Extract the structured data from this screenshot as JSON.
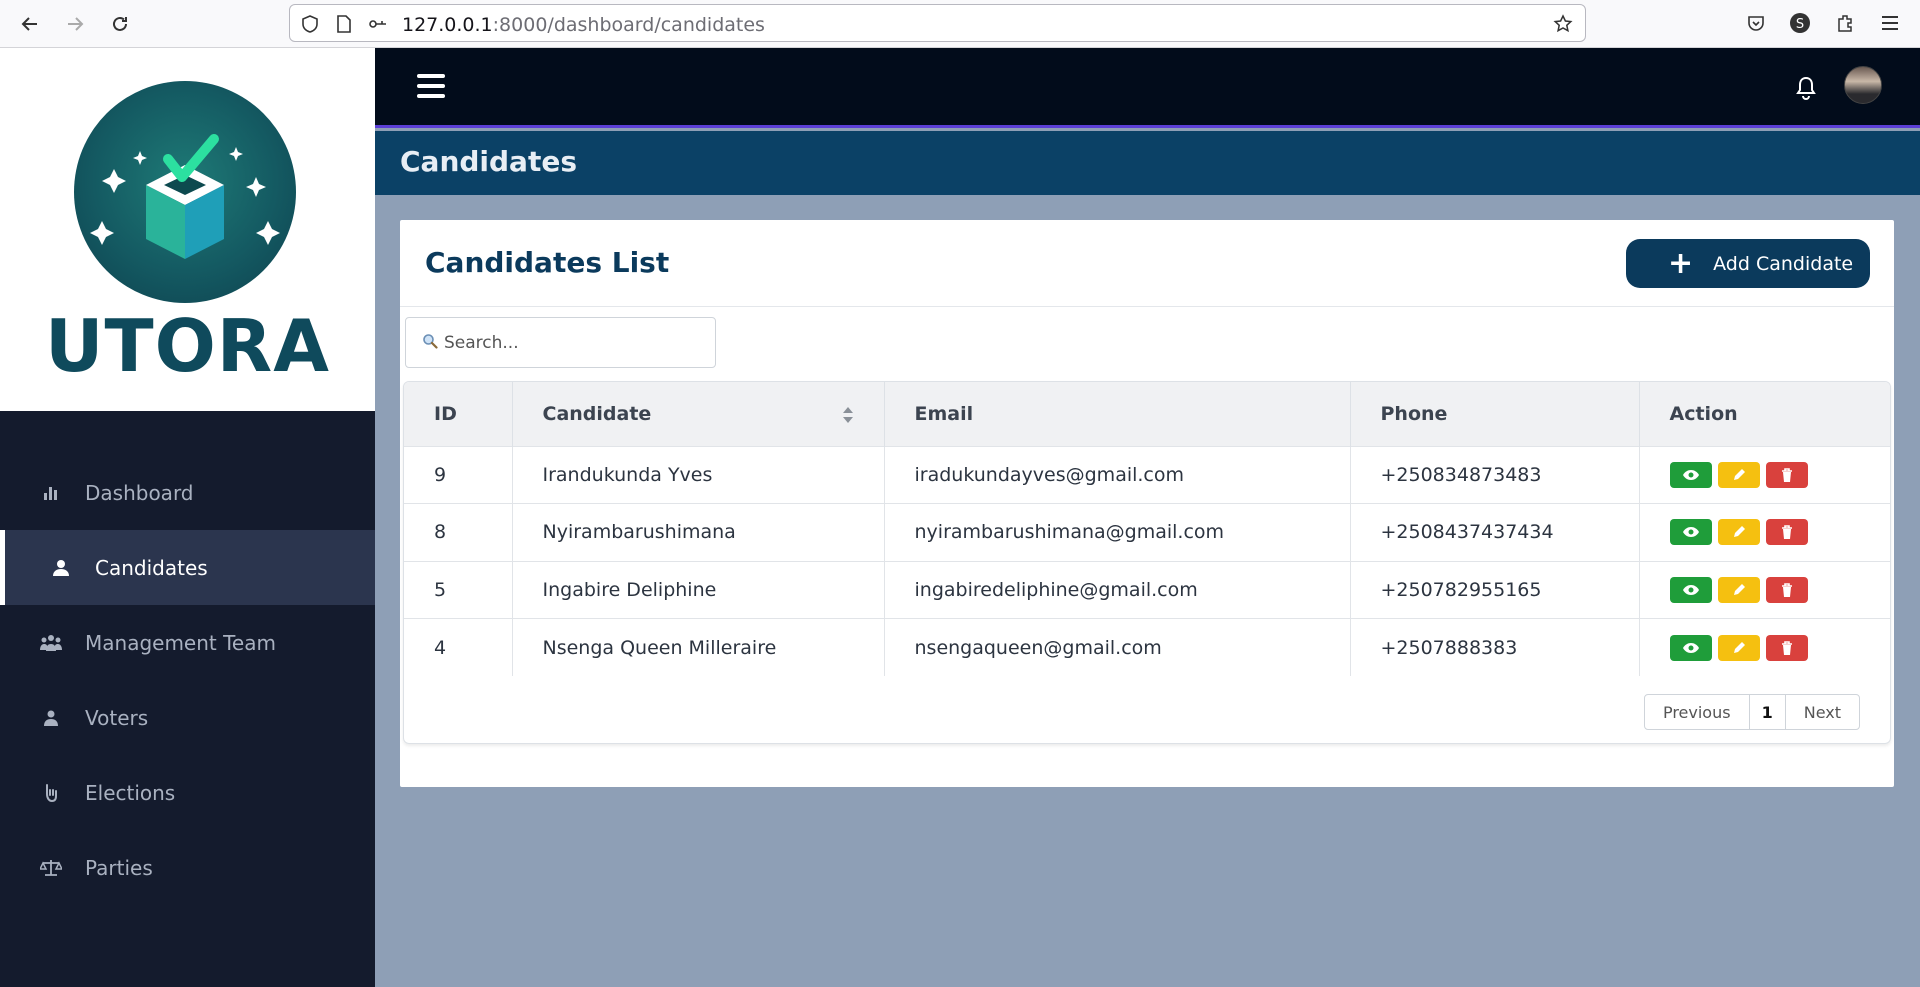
{
  "browser": {
    "url_host": "127.0.0.1",
    "url_rest": ":8000/dashboard/candidates"
  },
  "sidebar": {
    "logo_text": "UTORA",
    "items": [
      {
        "label": "Dashboard",
        "icon": "bar-chart-icon",
        "active": false
      },
      {
        "label": "Candidates",
        "icon": "user-icon",
        "active": true
      },
      {
        "label": "Management Team",
        "icon": "team-icon",
        "active": false
      },
      {
        "label": "Voters",
        "icon": "person-icon",
        "active": false
      },
      {
        "label": "Elections",
        "icon": "hand-vote-icon",
        "active": false
      },
      {
        "label": "Parties",
        "icon": "scale-icon",
        "active": false
      }
    ]
  },
  "page": {
    "title": "Candidates"
  },
  "card": {
    "title": "Candidates List",
    "add_button": "Add Candidate",
    "search_placeholder": "Search..."
  },
  "table": {
    "headers": [
      "ID",
      "Candidate",
      "Email",
      "Phone",
      "Action"
    ],
    "rows": [
      {
        "id": "9",
        "name": "Irandukunda Yves",
        "email": "iradukundayves@gmail.com",
        "phone": "+250834873483"
      },
      {
        "id": "8",
        "name": "Nyirambarushimana",
        "email": "nyirambarushimana@gmail.com",
        "phone": "+2508437437434"
      },
      {
        "id": "5",
        "name": "Ingabire Deliphine",
        "email": "ingabiredeliphine@gmail.com",
        "phone": "+250782955165"
      },
      {
        "id": "4",
        "name": "Nsenga Queen Milleraire",
        "email": "nsengaqueen@gmail.com",
        "phone": "+2507888383"
      }
    ]
  },
  "pagination": {
    "previous": "Previous",
    "current": "1",
    "next": "Next"
  },
  "colors": {
    "sidebar_bg": "#141b2d",
    "topbar_bg": "#020c1b",
    "header_bg": "#0b4166",
    "brand": "#0b3a5c",
    "view": "#1f9d3a",
    "edit": "#f5c010",
    "delete": "#d9413d"
  }
}
